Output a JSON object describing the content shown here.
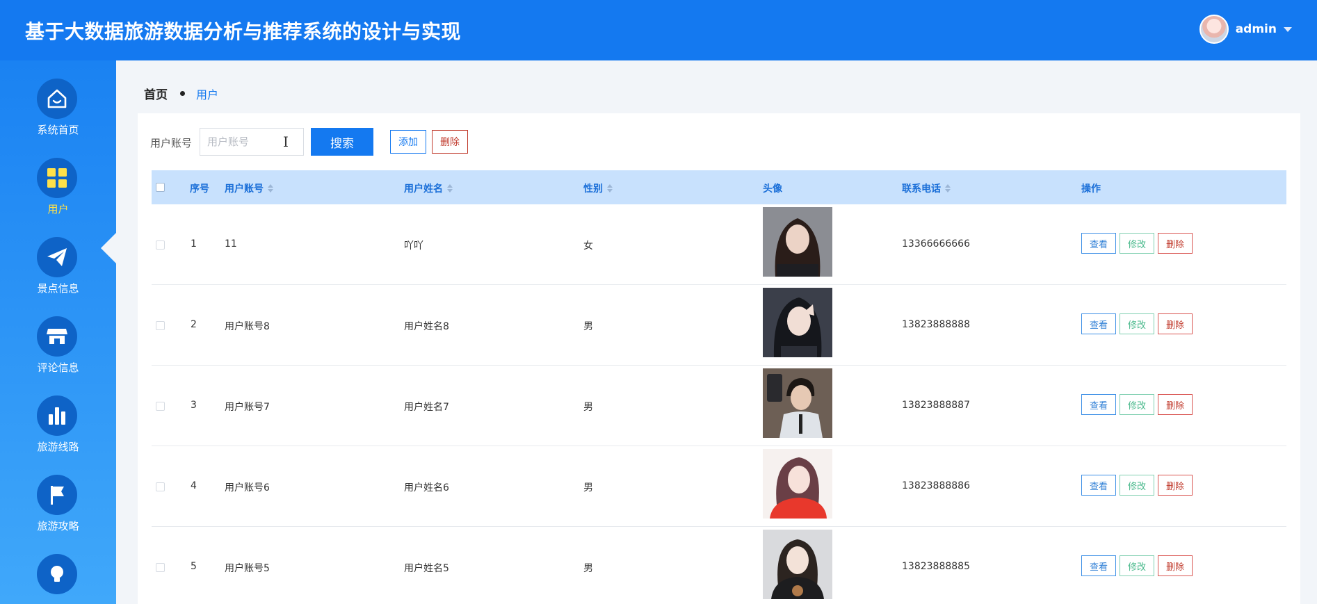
{
  "app": {
    "title": "基于大数据旅游数据分析与推荐系统的设计与实现"
  },
  "user": {
    "name": "admin"
  },
  "sidebar": {
    "items": [
      {
        "label": "系统首页",
        "icon": "home-icon"
      },
      {
        "label": "用户",
        "icon": "grid-icon",
        "active": true
      },
      {
        "label": "景点信息",
        "icon": "paper-plane-icon"
      },
      {
        "label": "评论信息",
        "icon": "store-icon"
      },
      {
        "label": "旅游线路",
        "icon": "bar-chart-icon"
      },
      {
        "label": "旅游攻略",
        "icon": "flag-icon"
      },
      {
        "label": "",
        "icon": "lightbulb-icon"
      }
    ]
  },
  "breadcrumb": {
    "home": "首页",
    "current": "用户"
  },
  "search": {
    "label": "用户账号",
    "placeholder": "用户账号",
    "button": "搜索"
  },
  "actions": {
    "add": "添加",
    "delete": "删除"
  },
  "table": {
    "columns": [
      "序号",
      "用户账号",
      "用户姓名",
      "性别",
      "头像",
      "联系电话",
      "操作"
    ],
    "row_actions": {
      "view": "查看",
      "edit": "修改",
      "delete": "删除"
    },
    "rows": [
      {
        "index": "1",
        "account": "11",
        "name": "吖吖",
        "gender": "女",
        "phone": "13366666666"
      },
      {
        "index": "2",
        "account": "用户账号8",
        "name": "用户姓名8",
        "gender": "男",
        "phone": "13823888888"
      },
      {
        "index": "3",
        "account": "用户账号7",
        "name": "用户姓名7",
        "gender": "男",
        "phone": "13823888887"
      },
      {
        "index": "4",
        "account": "用户账号6",
        "name": "用户姓名6",
        "gender": "男",
        "phone": "13823888886"
      },
      {
        "index": "5",
        "account": "用户账号5",
        "name": "用户姓名5",
        "gender": "男",
        "phone": "13823888885"
      }
    ]
  },
  "colors": {
    "primary": "#1479f0",
    "header_row": "#c8e1fd",
    "nav_icon_bg": "#0e63c7",
    "active_label": "#ffe14a",
    "danger": "#c0392b",
    "success": "#46b88a"
  }
}
